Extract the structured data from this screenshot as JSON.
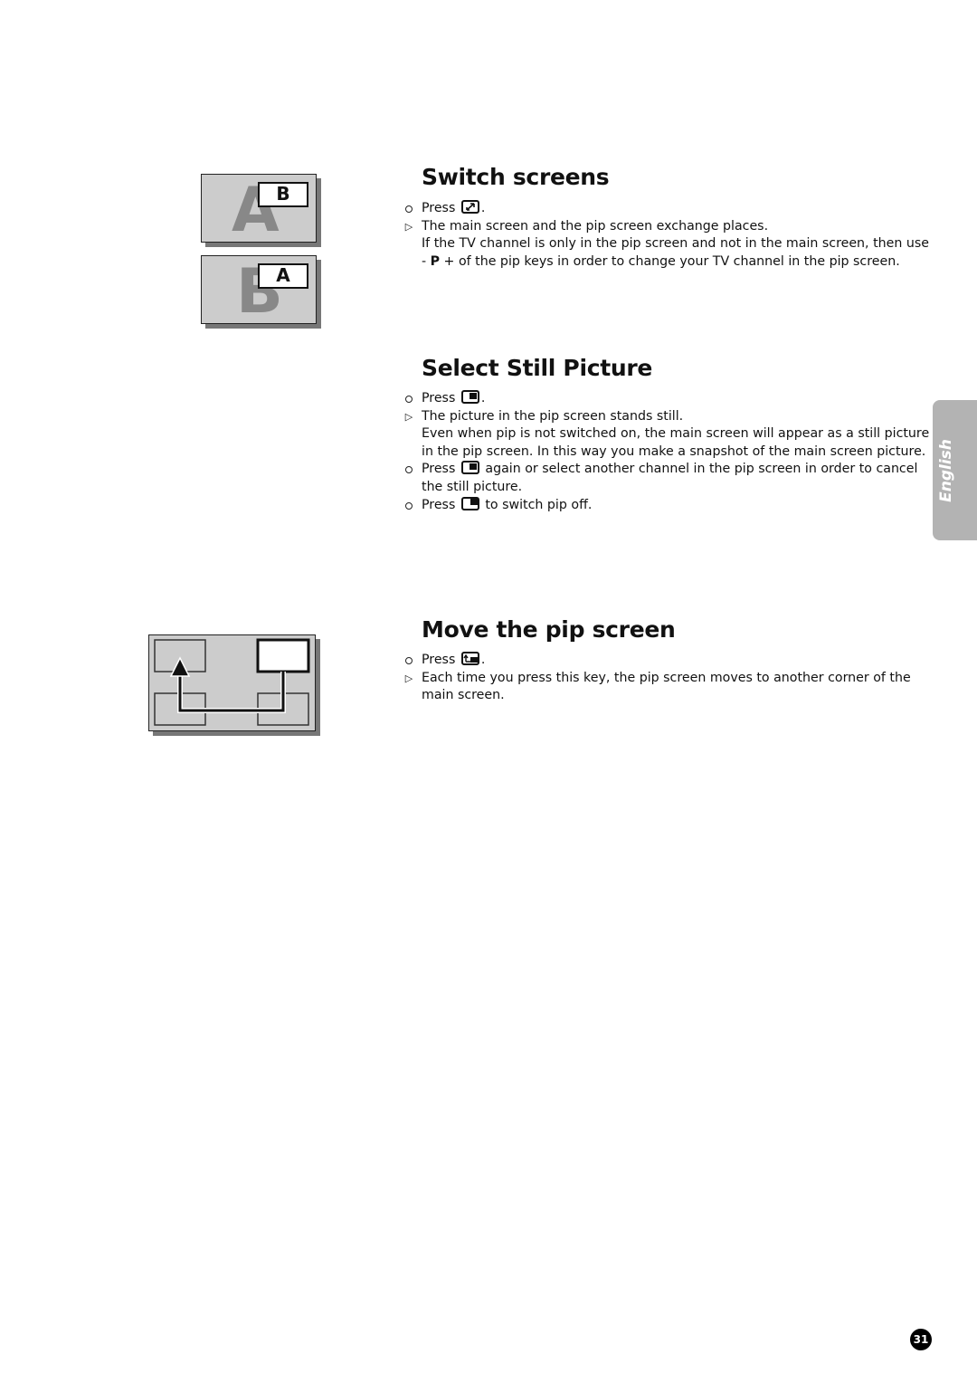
{
  "sections": [
    {
      "title": "Switch screens",
      "lines": [
        {
          "bullet": "circle",
          "pre": "Press",
          "key": "swap-key",
          "post": "."
        },
        {
          "bullet": "triangle",
          "text": "The main screen and the pip screen exchange places."
        },
        {
          "bullet": "none",
          "text": "If the TV channel is only in the pip screen and not in the main screen, then use"
        },
        {
          "bullet": "none",
          "pre": "- ",
          "bold": "P",
          "post": " + of the pip keys in order to change your TV channel in the pip screen."
        }
      ],
      "illustration": {
        "panels": [
          {
            "big_letter": "A",
            "pip_letter": "B"
          },
          {
            "big_letter": "B",
            "pip_letter": "A"
          }
        ]
      }
    },
    {
      "title": "Select Still Picture",
      "lines": [
        {
          "bullet": "circle",
          "pre": "Press",
          "key": "freeze-key",
          "post": "."
        },
        {
          "bullet": "triangle",
          "text": "The picture in the pip screen stands still."
        },
        {
          "bullet": "none",
          "text": "Even when pip is not switched on, the main screen will appear as a still picture"
        },
        {
          "bullet": "none",
          "text": "in the pip screen. In this way you make a snapshot of the main screen picture."
        },
        {
          "bullet": "circle",
          "pre": "Press",
          "key": "freeze-key",
          "post": " again or select another channel in the pip screen in order to cancel"
        },
        {
          "bullet": "none",
          "text": "the still picture."
        },
        {
          "bullet": "circle",
          "pre": "Press",
          "key": "pip-key",
          "post": " to switch pip off."
        }
      ]
    },
    {
      "title": "Move the pip screen",
      "lines": [
        {
          "bullet": "circle",
          "pre": "Press",
          "key": "move-key",
          "post": "."
        },
        {
          "bullet": "triangle",
          "text": "Each time you press this key, the pip screen moves to another corner of the"
        },
        {
          "bullet": "none",
          "text": "main screen."
        }
      ]
    }
  ],
  "language_tab": "English",
  "page_number": "31"
}
